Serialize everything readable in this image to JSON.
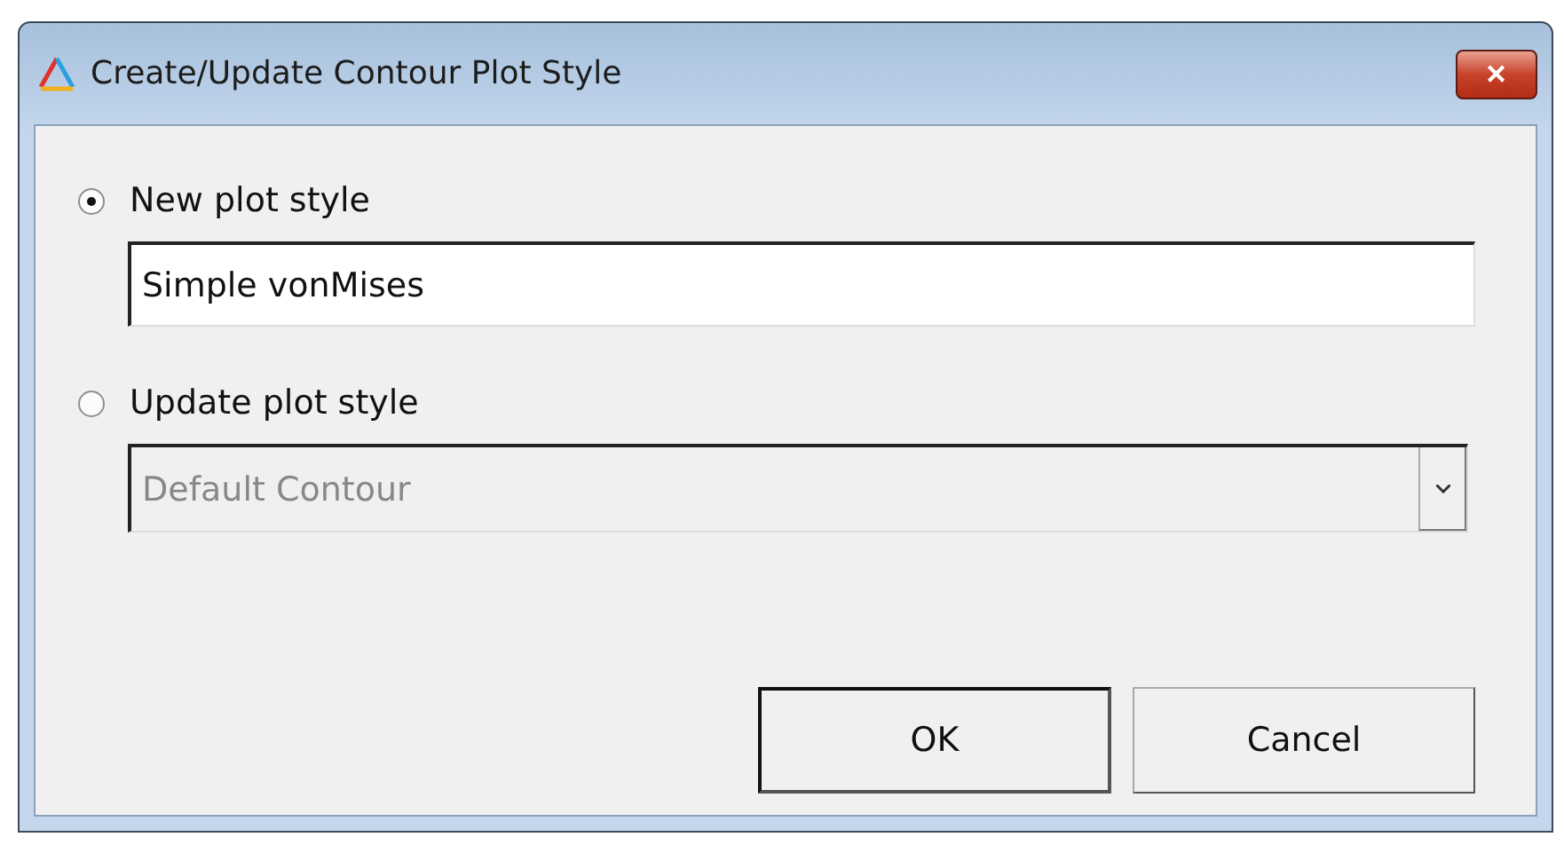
{
  "window": {
    "title": "Create/Update Contour Plot Style",
    "close_button": "✕"
  },
  "options": [
    {
      "label": "New plot style",
      "selected": true,
      "field": {
        "kind": "text",
        "value": "Simple vonMises",
        "disabled": false
      }
    },
    {
      "label": "Update plot style",
      "selected": false,
      "field": {
        "kind": "dropdown",
        "value": "Default Contour",
        "disabled": true
      }
    }
  ],
  "buttons": [
    {
      "label": "OK",
      "default": true
    },
    {
      "label": "Cancel",
      "default": false
    }
  ]
}
